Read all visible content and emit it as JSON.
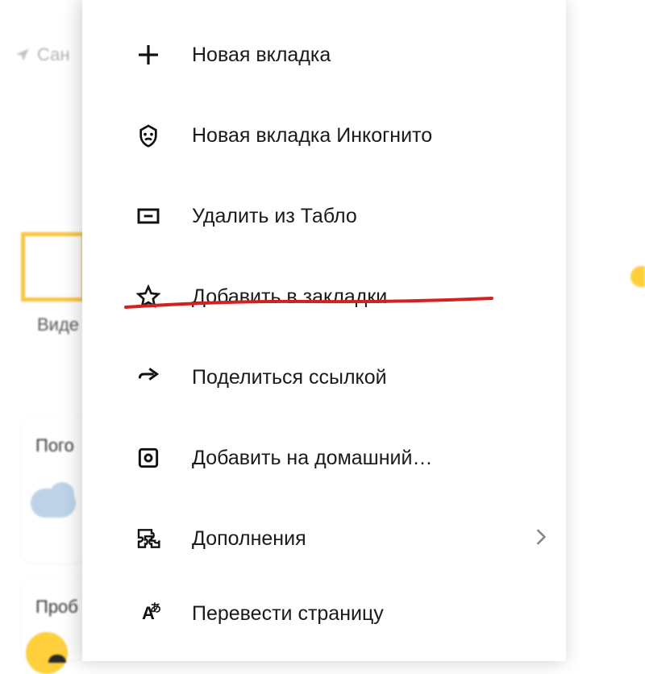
{
  "background": {
    "location_text": "Сан",
    "video_label": "Виде",
    "weather_label": "Пого",
    "traffic_label": "Проб"
  },
  "menu": {
    "items": [
      {
        "label": "Новая вкладка",
        "icon": "plus-icon",
        "chevron": false
      },
      {
        "label": "Новая вкладка Инкогнито",
        "icon": "incognito-icon",
        "chevron": false
      },
      {
        "label": "Удалить из Табло",
        "icon": "remove-tile-icon",
        "chevron": false
      },
      {
        "label": "Добавить в закладки",
        "icon": "star-icon",
        "chevron": false,
        "highlighted": true
      },
      {
        "label": "Поделиться ссылкой",
        "icon": "share-icon",
        "chevron": false
      },
      {
        "label": "Добавить на домашний…",
        "icon": "home-screen-icon",
        "chevron": false
      },
      {
        "label": "Дополнения",
        "icon": "extensions-icon",
        "chevron": true
      },
      {
        "label": "Перевести страницу",
        "icon": "translate-icon",
        "chevron": false
      }
    ]
  },
  "annotation": {
    "color": "#d32020"
  }
}
